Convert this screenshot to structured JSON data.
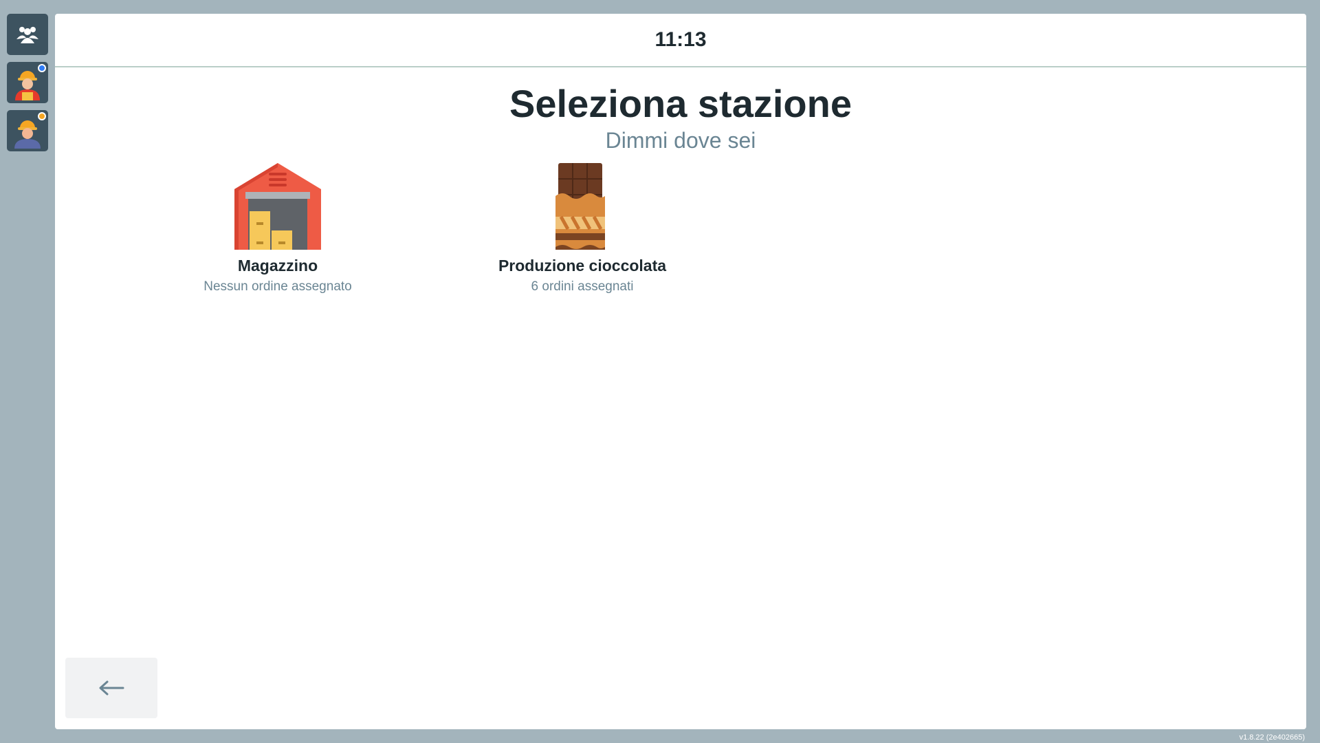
{
  "sidebar": {
    "items": [
      {
        "icon": "team-icon"
      },
      {
        "icon": "worker-icon",
        "badge_color": "#2f7cf6"
      },
      {
        "icon": "worker-helmet-icon",
        "badge_color": "#f5a623"
      }
    ]
  },
  "header": {
    "clock": "11:13"
  },
  "main": {
    "title": "Seleziona stazione",
    "subtitle": "Dimmi dove sei"
  },
  "stations": [
    {
      "name": "Magazzino",
      "status": "Nessun ordine assegnato",
      "icon": "warehouse-icon"
    },
    {
      "name": "Produzione cioccolata",
      "status": "6 ordini assegnati",
      "icon": "chocolate-bar-icon"
    }
  ],
  "footer": {
    "back_icon": "arrow-left-icon",
    "version": "v1.8.22 (2e402665)"
  },
  "colors": {
    "background": "#a3b4bc",
    "sidebar_button": "#3d5360",
    "text_dark": "#1e2a30",
    "text_muted": "#6a8593"
  }
}
